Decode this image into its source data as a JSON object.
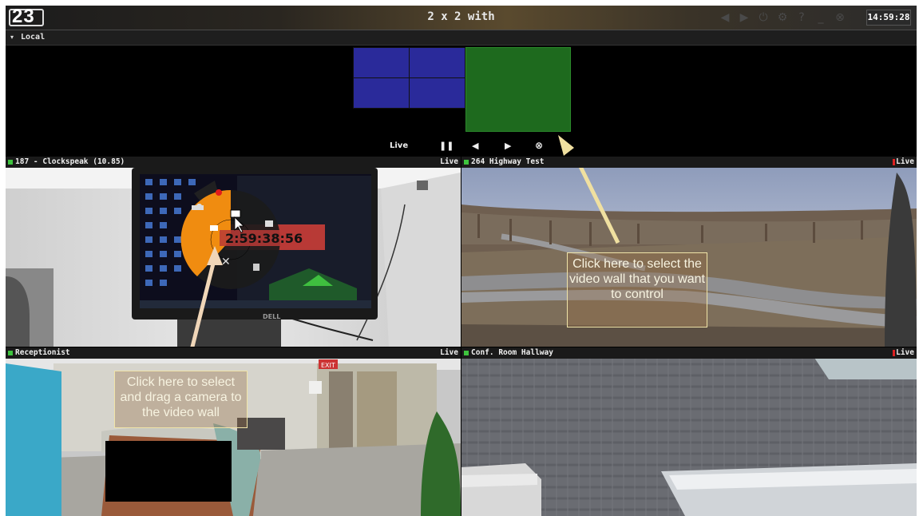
{
  "window": {
    "logo": "23",
    "title": "2 x 2 with",
    "clock": "14:59:28",
    "toolbar_icons": [
      "prev-icon",
      "next-icon",
      "power-icon",
      "settings-icon",
      "help-icon",
      "minimize-icon",
      "close-icon"
    ],
    "toolbar_glyphs": [
      "◀",
      "▶",
      "⏻",
      "⚙",
      "?",
      "_",
      "⊗"
    ]
  },
  "local_section": {
    "label": "Local",
    "arrow": "▾"
  },
  "video_wall": {
    "controls": {
      "live": "Live",
      "pause": "❚❚",
      "prev": "◀",
      "next": "▶",
      "close": "⊗"
    }
  },
  "tiles": [
    {
      "name": "187 - Clockspeak (10.85)",
      "status": "Live",
      "status_color": "#3ec43e",
      "recording": false
    },
    {
      "name": "264 Highway Test",
      "status": "Live",
      "status_color": "#3ec43e",
      "recording": true
    },
    {
      "name": "Receptionist",
      "status": "Live",
      "status_color": "#3ec43e",
      "recording": false
    },
    {
      "name": "Conf. Room Hallway",
      "status": "Live",
      "status_color": "#3ec43e",
      "recording": true
    }
  ],
  "overlay": {
    "monitor_time": "2:59:38:56",
    "monitor_brand": "DELL",
    "exit_sign": "EXIT"
  },
  "callouts": {
    "video_wall": "Click here to select the video wall that you want to control",
    "camera": "Click here to select and drag a camera to the video wall"
  },
  "colors": {
    "accent_orange": "#f08c10",
    "wall_blue": "#2a2a9a",
    "wall_green": "#1e6a1e",
    "live_green": "#3ec43e",
    "record_red": "#d22222",
    "callout_border": "#f0e4a8"
  }
}
